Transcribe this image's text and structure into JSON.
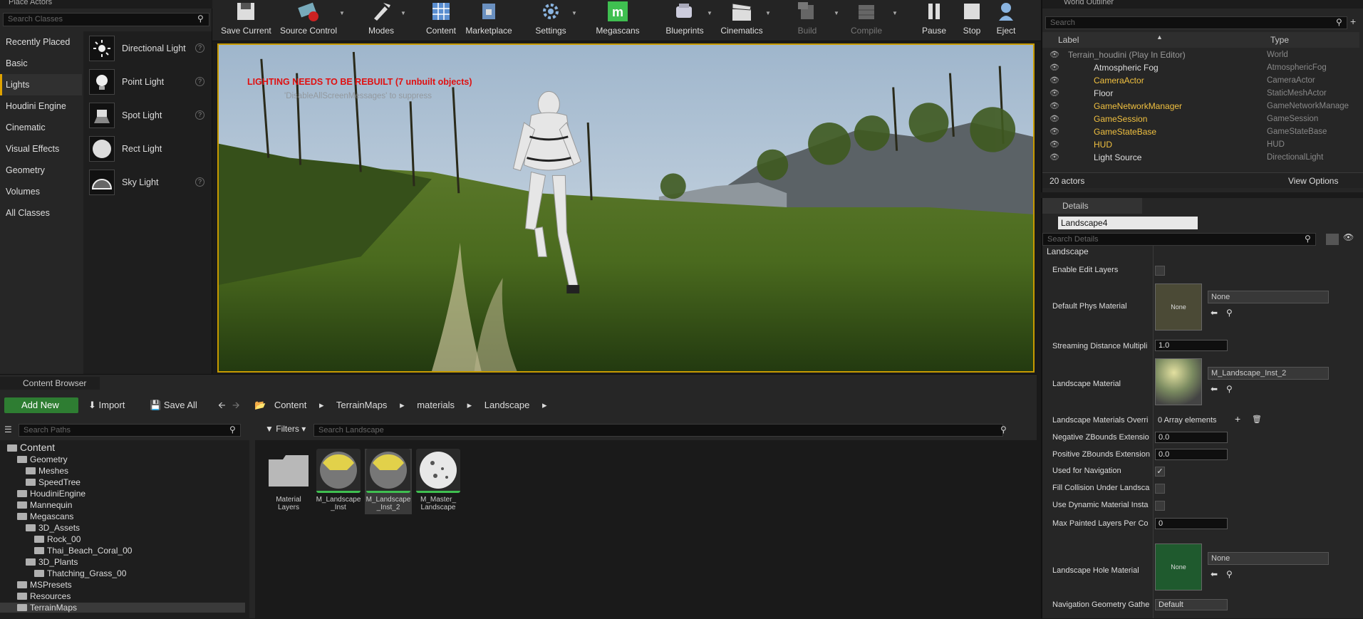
{
  "place_actors": {
    "tab_title": "Place Actors",
    "search_placeholder": "Search Classes",
    "categories": [
      "Recently Placed",
      "Basic",
      "Lights",
      "Houdini Engine",
      "Cinematic",
      "Visual Effects",
      "Geometry",
      "Volumes",
      "All Classes"
    ],
    "active_category": "Lights",
    "items": [
      "Directional Light",
      "Point Light",
      "Spot Light",
      "Rect Light",
      "Sky Light"
    ]
  },
  "toolbar": {
    "buttons": [
      "Save Current",
      "Source Control",
      "Modes",
      "Content",
      "Marketplace",
      "Settings",
      "Megascans",
      "Blueprints",
      "Cinematics",
      "Build",
      "Compile",
      "Pause",
      "Stop",
      "Eject"
    ]
  },
  "viewport": {
    "warning": "LIGHTING NEEDS TO BE REBUILT (7 unbuilt objects)",
    "hint": "'DisableAllScreenMessages' to suppress"
  },
  "outliner": {
    "tab_title": "World Outliner",
    "search_placeholder": "Search",
    "col_label": "Label",
    "col_type": "Type",
    "rows": [
      {
        "label": "Terrain_houdini (Play In Editor)",
        "type": "World"
      },
      {
        "label": "Atmospheric Fog",
        "type": "AtmosphericFog"
      },
      {
        "label": "CameraActor",
        "type": "CameraActor"
      },
      {
        "label": "Floor",
        "type": "StaticMeshActor"
      },
      {
        "label": "GameNetworkManager",
        "type": "GameNetworkManage"
      },
      {
        "label": "GameSession",
        "type": "GameSession"
      },
      {
        "label": "GameStateBase",
        "type": "GameStateBase"
      },
      {
        "label": "HUD",
        "type": "HUD"
      },
      {
        "label": "Light Source",
        "type": "DirectionalLight"
      }
    ],
    "count": "20 actors",
    "view_options": "View Options"
  },
  "details": {
    "tab_title": "Details",
    "name_value": "Landscape4",
    "search_placeholder": "Search Details",
    "section": "Landscape",
    "enable_edit_layers": "Enable Edit Layers",
    "default_phys_material": "Default Phys Material",
    "none": "None",
    "streaming_distance": "Streaming Distance Multipli",
    "streaming_value": "1.0",
    "landscape_material": "Landscape Material",
    "landscape_material_value": "M_Landscape_Inst_2",
    "materials_override": "Landscape Materials Overri",
    "array_elements": "0 Array elements",
    "neg_z": "Negative ZBounds Extensio",
    "pos_z": "Positive ZBounds Extension",
    "zero": "0.0",
    "used_nav": "Used for Navigation",
    "fill_collision": "Fill Collision Under Landsca",
    "dyn_material": "Use Dynamic Material Insta",
    "max_layers": "Max Painted Layers Per Co",
    "max_layers_value": "0",
    "hole_material": "Landscape Hole Material",
    "nav_geometry": "Navigation Geometry Gathe",
    "nav_default": "Default"
  },
  "content_browser": {
    "tab_title": "Content Browser",
    "add_new": "Add New",
    "import": "Import",
    "save_all": "Save All",
    "path": [
      "Content",
      "TerrainMaps",
      "materials",
      "Landscape"
    ],
    "search_paths": "Search Paths",
    "filters": "Filters",
    "search_assets": "Search Landscape",
    "tree": [
      {
        "label": "Content",
        "depth": 0
      },
      {
        "label": "Geometry",
        "depth": 1
      },
      {
        "label": "Meshes",
        "depth": 2
      },
      {
        "label": "SpeedTree",
        "depth": 2
      },
      {
        "label": "HoudiniEngine",
        "depth": 1
      },
      {
        "label": "Mannequin",
        "depth": 1
      },
      {
        "label": "Megascans",
        "depth": 1
      },
      {
        "label": "3D_Assets",
        "depth": 2
      },
      {
        "label": "Rock_00",
        "depth": 3
      },
      {
        "label": "Thai_Beach_Coral_00",
        "depth": 3
      },
      {
        "label": "3D_Plants",
        "depth": 2
      },
      {
        "label": "Thatching_Grass_00",
        "depth": 3
      },
      {
        "label": "MSPresets",
        "depth": 1
      },
      {
        "label": "Resources",
        "depth": 1
      },
      {
        "label": "TerrainMaps",
        "depth": 1
      }
    ],
    "assets": [
      {
        "l1": "Material",
        "l2": "Layers"
      },
      {
        "l1": "M_Landscape",
        "l2": "_Inst"
      },
      {
        "l1": "M_Landscape",
        "l2": "_Inst_2"
      },
      {
        "l1": "M_Master_",
        "l2": "Landscape"
      }
    ]
  },
  "colors": {
    "accent": "#e0a300",
    "add_new": "#2e7d32",
    "selection_border": "#c79a00"
  }
}
